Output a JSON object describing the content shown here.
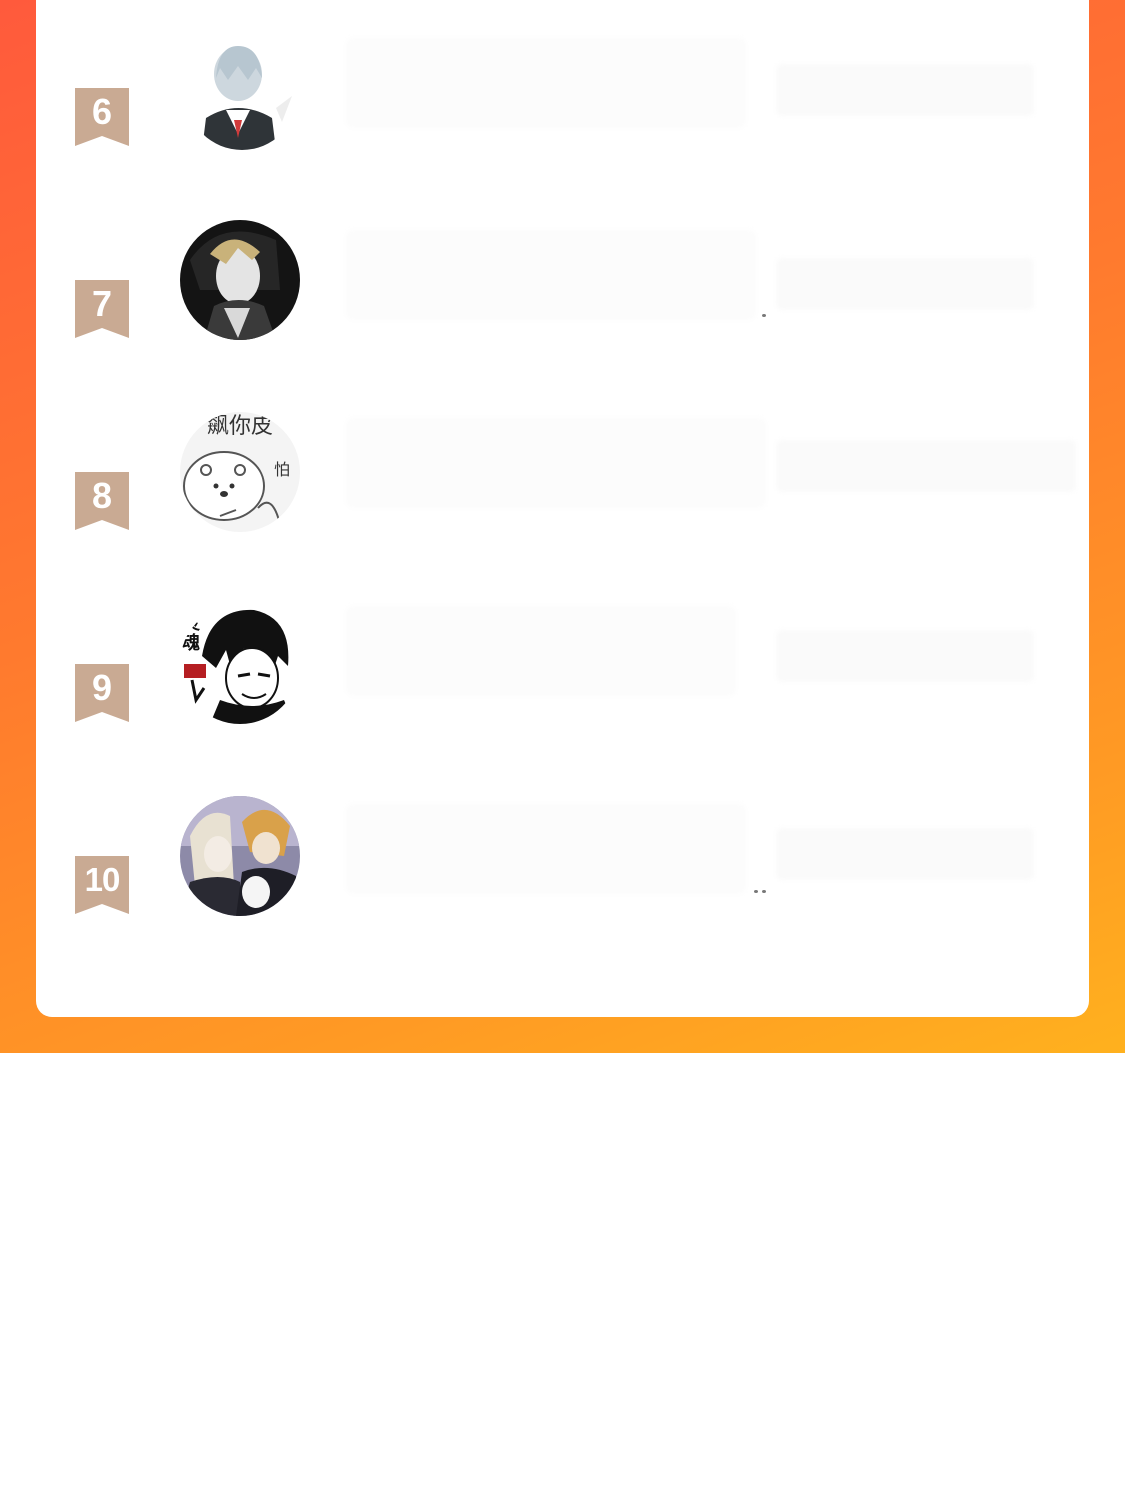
{
  "ranking": {
    "rows": [
      {
        "rank": "6",
        "avatar_caption": ""
      },
      {
        "rank": "7",
        "avatar_caption": ""
      },
      {
        "rank": "8",
        "avatar_caption": "飙你皮",
        "avatar_side_text": "怕"
      },
      {
        "rank": "9",
        "avatar_caption": "",
        "avatar_side_text": "灵魂"
      },
      {
        "rank": "10",
        "avatar_caption": ""
      }
    ]
  },
  "colors": {
    "gradient_start": "#ff5a3c",
    "gradient_end": "#ffb11e",
    "badge": "#c9aa93",
    "card": "#ffffff"
  },
  "icons": {
    "rank_badge": "bookmark-ribbon-icon"
  }
}
